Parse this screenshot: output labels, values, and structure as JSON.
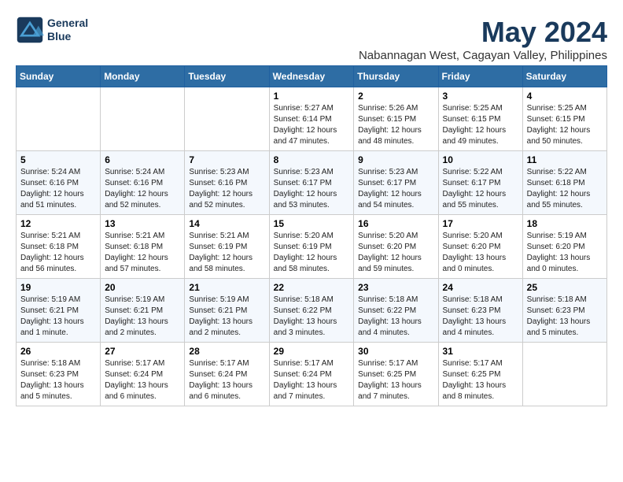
{
  "logo": {
    "line1": "General",
    "line2": "Blue"
  },
  "title": "May 2024",
  "subtitle": "Nabannagan West, Cagayan Valley, Philippines",
  "weekdays": [
    "Sunday",
    "Monday",
    "Tuesday",
    "Wednesday",
    "Thursday",
    "Friday",
    "Saturday"
  ],
  "weeks": [
    [
      {
        "day": "",
        "info": ""
      },
      {
        "day": "",
        "info": ""
      },
      {
        "day": "",
        "info": ""
      },
      {
        "day": "1",
        "info": "Sunrise: 5:27 AM\nSunset: 6:14 PM\nDaylight: 12 hours and 47 minutes."
      },
      {
        "day": "2",
        "info": "Sunrise: 5:26 AM\nSunset: 6:15 PM\nDaylight: 12 hours and 48 minutes."
      },
      {
        "day": "3",
        "info": "Sunrise: 5:25 AM\nSunset: 6:15 PM\nDaylight: 12 hours and 49 minutes."
      },
      {
        "day": "4",
        "info": "Sunrise: 5:25 AM\nSunset: 6:15 PM\nDaylight: 12 hours and 50 minutes."
      }
    ],
    [
      {
        "day": "5",
        "info": "Sunrise: 5:24 AM\nSunset: 6:16 PM\nDaylight: 12 hours and 51 minutes."
      },
      {
        "day": "6",
        "info": "Sunrise: 5:24 AM\nSunset: 6:16 PM\nDaylight: 12 hours and 52 minutes."
      },
      {
        "day": "7",
        "info": "Sunrise: 5:23 AM\nSunset: 6:16 PM\nDaylight: 12 hours and 52 minutes."
      },
      {
        "day": "8",
        "info": "Sunrise: 5:23 AM\nSunset: 6:17 PM\nDaylight: 12 hours and 53 minutes."
      },
      {
        "day": "9",
        "info": "Sunrise: 5:23 AM\nSunset: 6:17 PM\nDaylight: 12 hours and 54 minutes."
      },
      {
        "day": "10",
        "info": "Sunrise: 5:22 AM\nSunset: 6:17 PM\nDaylight: 12 hours and 55 minutes."
      },
      {
        "day": "11",
        "info": "Sunrise: 5:22 AM\nSunset: 6:18 PM\nDaylight: 12 hours and 55 minutes."
      }
    ],
    [
      {
        "day": "12",
        "info": "Sunrise: 5:21 AM\nSunset: 6:18 PM\nDaylight: 12 hours and 56 minutes."
      },
      {
        "day": "13",
        "info": "Sunrise: 5:21 AM\nSunset: 6:18 PM\nDaylight: 12 hours and 57 minutes."
      },
      {
        "day": "14",
        "info": "Sunrise: 5:21 AM\nSunset: 6:19 PM\nDaylight: 12 hours and 58 minutes."
      },
      {
        "day": "15",
        "info": "Sunrise: 5:20 AM\nSunset: 6:19 PM\nDaylight: 12 hours and 58 minutes."
      },
      {
        "day": "16",
        "info": "Sunrise: 5:20 AM\nSunset: 6:20 PM\nDaylight: 12 hours and 59 minutes."
      },
      {
        "day": "17",
        "info": "Sunrise: 5:20 AM\nSunset: 6:20 PM\nDaylight: 13 hours and 0 minutes."
      },
      {
        "day": "18",
        "info": "Sunrise: 5:19 AM\nSunset: 6:20 PM\nDaylight: 13 hours and 0 minutes."
      }
    ],
    [
      {
        "day": "19",
        "info": "Sunrise: 5:19 AM\nSunset: 6:21 PM\nDaylight: 13 hours and 1 minute."
      },
      {
        "day": "20",
        "info": "Sunrise: 5:19 AM\nSunset: 6:21 PM\nDaylight: 13 hours and 2 minutes."
      },
      {
        "day": "21",
        "info": "Sunrise: 5:19 AM\nSunset: 6:21 PM\nDaylight: 13 hours and 2 minutes."
      },
      {
        "day": "22",
        "info": "Sunrise: 5:18 AM\nSunset: 6:22 PM\nDaylight: 13 hours and 3 minutes."
      },
      {
        "day": "23",
        "info": "Sunrise: 5:18 AM\nSunset: 6:22 PM\nDaylight: 13 hours and 4 minutes."
      },
      {
        "day": "24",
        "info": "Sunrise: 5:18 AM\nSunset: 6:23 PM\nDaylight: 13 hours and 4 minutes."
      },
      {
        "day": "25",
        "info": "Sunrise: 5:18 AM\nSunset: 6:23 PM\nDaylight: 13 hours and 5 minutes."
      }
    ],
    [
      {
        "day": "26",
        "info": "Sunrise: 5:18 AM\nSunset: 6:23 PM\nDaylight: 13 hours and 5 minutes."
      },
      {
        "day": "27",
        "info": "Sunrise: 5:17 AM\nSunset: 6:24 PM\nDaylight: 13 hours and 6 minutes."
      },
      {
        "day": "28",
        "info": "Sunrise: 5:17 AM\nSunset: 6:24 PM\nDaylight: 13 hours and 6 minutes."
      },
      {
        "day": "29",
        "info": "Sunrise: 5:17 AM\nSunset: 6:24 PM\nDaylight: 13 hours and 7 minutes."
      },
      {
        "day": "30",
        "info": "Sunrise: 5:17 AM\nSunset: 6:25 PM\nDaylight: 13 hours and 7 minutes."
      },
      {
        "day": "31",
        "info": "Sunrise: 5:17 AM\nSunset: 6:25 PM\nDaylight: 13 hours and 8 minutes."
      },
      {
        "day": "",
        "info": ""
      }
    ]
  ]
}
